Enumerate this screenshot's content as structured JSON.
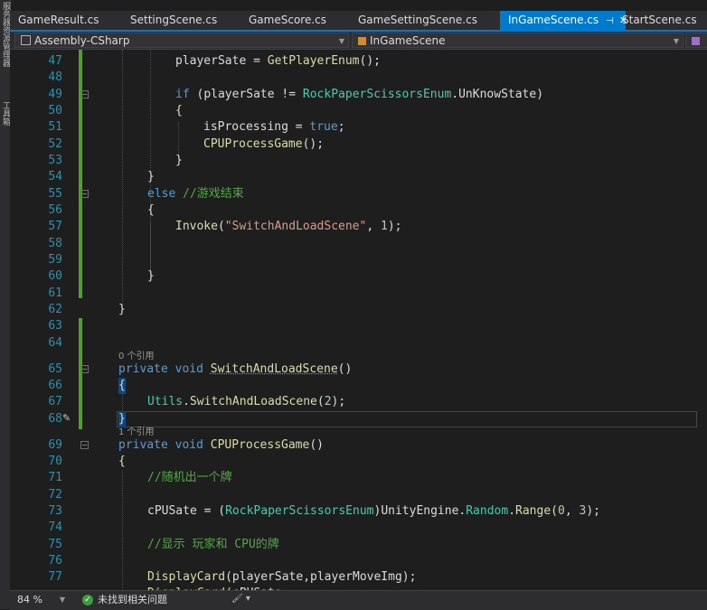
{
  "sidebar": {
    "labels": [
      "服务器资源管理器",
      "工具箱"
    ]
  },
  "tabs": [
    {
      "label": "GameResult.cs",
      "active": false
    },
    {
      "label": "SettingScene.cs",
      "active": false
    },
    {
      "label": "GameScore.cs",
      "active": false
    },
    {
      "label": "GameSettingScene.cs",
      "active": false
    },
    {
      "label": "InGameScene.cs",
      "active": true
    },
    {
      "label": "StartScene.cs",
      "active": false
    }
  ],
  "navbar": {
    "project": "Assembly-CSharp",
    "class": "InGameScene"
  },
  "code_lens": {
    "l65": "0 个引用",
    "l69": "1 个引用"
  },
  "code": {
    "line_numbers": [
      "47",
      "48",
      "49",
      "50",
      "51",
      "52",
      "53",
      "54",
      "55",
      "56",
      "57",
      "58",
      "59",
      "60",
      "61",
      "62",
      "63",
      "64",
      "65",
      "66",
      "67",
      "68",
      "69",
      "70",
      "71",
      "72",
      "73",
      "74",
      "75",
      "76",
      "77"
    ],
    "id_playerSate": "playerSate",
    "m_GetPlayerEnum": "GetPlayerEnum",
    "kw_if": "if",
    "t_RockPaperScissorsEnum": "RockPaperScissorsEnum",
    "enum_UnKnowState": "UnKnowState",
    "id_isProcessing": "isProcessing",
    "kw_true": "true",
    "m_CPUProcessGame": "CPUProcessGame",
    "kw_else": "else",
    "cm_gameover": "//游戏结束",
    "m_Invoke": "Invoke",
    "str_switch": "\"SwitchAndLoadScene\"",
    "num_1": "1",
    "kw_private": "private",
    "kw_void": "void",
    "m_SwitchAndLoadScene": "SwitchAndLoadScene",
    "t_Utils": "Utils",
    "num_2": "2",
    "cm_random": "//随机出一个牌",
    "id_cPUSate": "cPUSate",
    "id_UnityEngine": "UnityEngine",
    "t_Random": "Random",
    "m_Range": "Range",
    "num_0": "0",
    "num_3": "3",
    "cm_show": "//显示 玩家和 CPU的牌",
    "m_DisplayCard": "DisplayCard",
    "id_playerMoveImg": "playerMoveImg"
  },
  "status": {
    "zoom": "84 %",
    "issues": "未找到相关问题"
  },
  "colors": {
    "accent": "#007acc",
    "keyword": "#569cd6",
    "type": "#4ec9b0",
    "method": "#dcdcaa",
    "string": "#d69d85",
    "comment": "#57a64a",
    "change_saved": "#579c2e",
    "change_unsaved": "#efc700"
  }
}
